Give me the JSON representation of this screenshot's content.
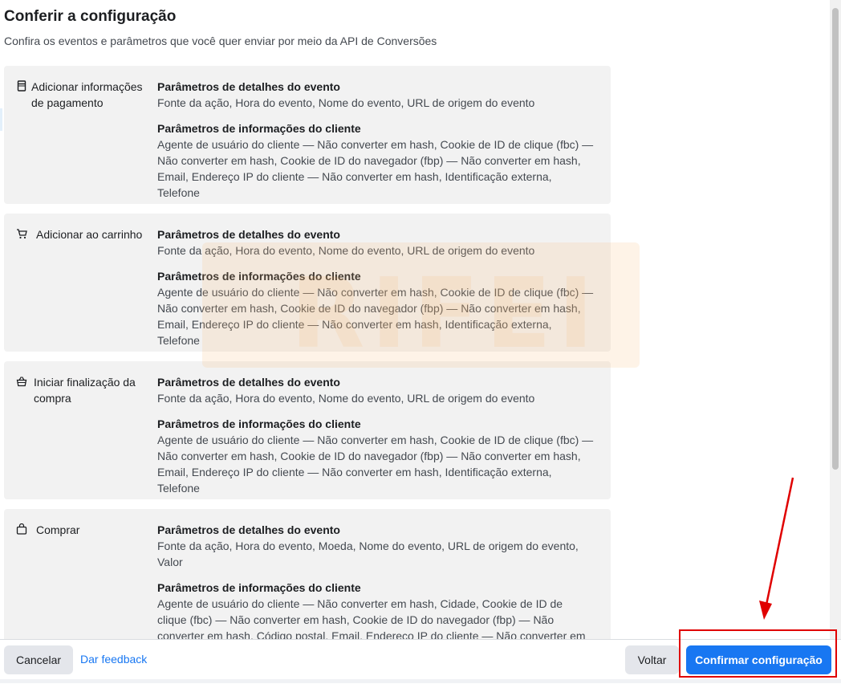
{
  "page": {
    "title": "Conferir a configuração",
    "subtitle": "Confira os eventos e parâmetros que você quer enviar por meio da API de Conversões"
  },
  "watermark_text": "RIFEI",
  "events": [
    {
      "icon": "credit-card-icon",
      "name": "Adicionar informações de pagamento",
      "event_params_heading": "Parâmetros de detalhes do evento",
      "event_params": "Fonte da ação, Hora do evento, Nome do evento, URL de origem do evento",
      "customer_params_heading": "Parâmetros de informações do cliente",
      "customer_params": "Agente de usuário do cliente — Não converter em hash, Cookie de ID de clique (fbc) — Não converter em hash, Cookie de ID do navegador (fbp) — Não converter em hash, Email, Endereço IP do cliente — Não converter em hash, Identificação externa, Telefone"
    },
    {
      "icon": "cart-icon",
      "name": "Adicionar ao carrinho",
      "event_params_heading": "Parâmetros de detalhes do evento",
      "event_params": "Fonte da ação, Hora do evento, Nome do evento, URL de origem do evento",
      "customer_params_heading": "Parâmetros de informações do cliente",
      "customer_params": "Agente de usuário do cliente — Não converter em hash, Cookie de ID de clique (fbc) — Não converter em hash, Cookie de ID do navegador (fbp) — Não converter em hash, Email, Endereço IP do cliente — Não converter em hash, Identificação externa, Telefone"
    },
    {
      "icon": "basket-icon",
      "name": "Iniciar finalização da compra",
      "event_params_heading": "Parâmetros de detalhes do evento",
      "event_params": "Fonte da ação, Hora do evento, Nome do evento, URL de origem do evento",
      "customer_params_heading": "Parâmetros de informações do cliente",
      "customer_params": "Agente de usuário do cliente — Não converter em hash, Cookie de ID de clique (fbc) — Não converter em hash, Cookie de ID do navegador (fbp) — Não converter em hash, Email, Endereço IP do cliente — Não converter em hash, Identificação externa, Telefone"
    },
    {
      "icon": "shopping-bag-icon",
      "name": "Comprar",
      "event_params_heading": "Parâmetros de detalhes do evento",
      "event_params": "Fonte da ação, Hora do evento, Moeda, Nome do evento, URL de origem do evento, Valor",
      "customer_params_heading": "Parâmetros de informações do cliente",
      "customer_params": "Agente de usuário do cliente — Não converter em hash, Cidade, Cookie de ID de clique (fbc) — Não converter em hash, Cookie de ID do navegador (fbp) — Não converter em hash, Código postal, Email, Endereço IP do cliente — Não converter em hash, Estado"
    }
  ],
  "footer": {
    "cancel_label": "Cancelar",
    "feedback_label": "Dar feedback",
    "back_label": "Voltar",
    "confirm_label": "Confirmar configuração"
  },
  "colors": {
    "primary": "#1877f2",
    "card_bg": "#f2f2f2",
    "annotation_red": "#e00000"
  }
}
